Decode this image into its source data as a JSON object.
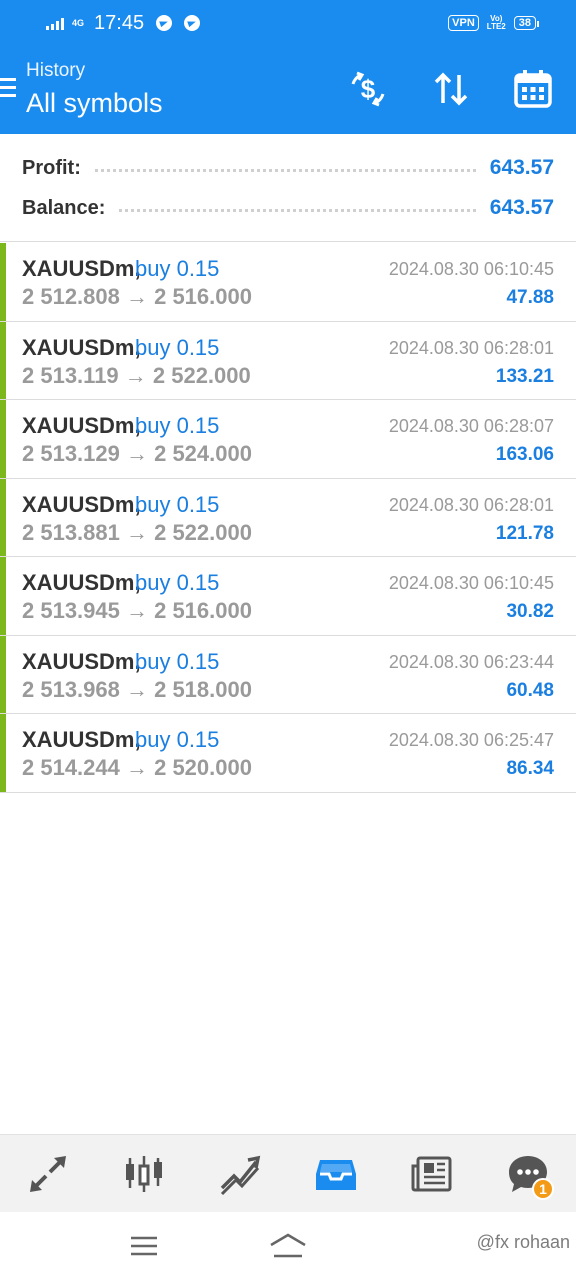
{
  "status_bar": {
    "network": "4G",
    "time": "17:45",
    "vpn": "VPN",
    "volte_top": "Vo)",
    "volte_bottom": "LTE2",
    "battery": "38"
  },
  "header": {
    "subtitle": "History",
    "title": "All symbols",
    "icons": [
      "currency-exchange-icon",
      "sort-icon",
      "calendar-icon"
    ]
  },
  "summary": {
    "profit_label": "Profit:",
    "profit_value": "643.57",
    "balance_label": "Balance:",
    "balance_value": "643.57"
  },
  "deals": [
    {
      "symbol": "XAUUSDm,",
      "side": "buy 0.15",
      "time": "2024.08.30 06:10:45",
      "prices": "2 512.808 → 2 516.000",
      "profit": "47.88"
    },
    {
      "symbol": "XAUUSDm,",
      "side": "buy 0.15",
      "time": "2024.08.30 06:28:01",
      "prices": "2 513.119 → 2 522.000",
      "profit": "133.21"
    },
    {
      "symbol": "XAUUSDm,",
      "side": "buy 0.15",
      "time": "2024.08.30 06:28:07",
      "prices": "2 513.129 → 2 524.000",
      "profit": "163.06"
    },
    {
      "symbol": "XAUUSDm,",
      "side": "buy 0.15",
      "time": "2024.08.30 06:28:01",
      "prices": "2 513.881 → 2 522.000",
      "profit": "121.78"
    },
    {
      "symbol": "XAUUSDm,",
      "side": "buy 0.15",
      "time": "2024.08.30 06:10:45",
      "prices": "2 513.945 → 2 516.000",
      "profit": "30.82"
    },
    {
      "symbol": "XAUUSDm,",
      "side": "buy 0.15",
      "time": "2024.08.30 06:23:44",
      "prices": "2 513.968 → 2 518.000",
      "profit": "60.48"
    },
    {
      "symbol": "XAUUSDm,",
      "side": "buy 0.15",
      "time": "2024.08.30 06:25:47",
      "prices": "2 514.244 → 2 520.000",
      "profit": "86.34"
    }
  ],
  "bottom_nav": {
    "items": [
      "quotes-icon",
      "chart-icon",
      "trade-icon",
      "history-icon",
      "news-icon",
      "chat-icon"
    ],
    "active": "history-icon",
    "chat_badge": "1"
  },
  "watermark": "@fx rohaan",
  "colors": {
    "header_bg": "#1a8cf0",
    "accent_blue": "#1a7fe0",
    "buy_bar": "#7cb81c",
    "badge": "#f39a16"
  }
}
